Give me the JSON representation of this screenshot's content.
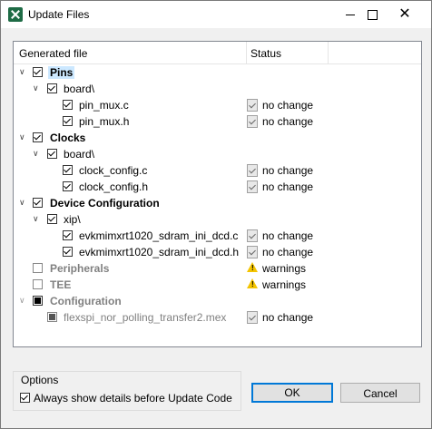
{
  "window": {
    "title": "Update Files"
  },
  "table": {
    "col_file": "Generated file",
    "col_status": "Status"
  },
  "rows": [
    {
      "label": "Pins",
      "status": ""
    },
    {
      "label": "board\\",
      "status": ""
    },
    {
      "label": "pin_mux.c",
      "status": "no change"
    },
    {
      "label": "pin_mux.h",
      "status": "no change"
    },
    {
      "label": "Clocks",
      "status": ""
    },
    {
      "label": "board\\",
      "status": ""
    },
    {
      "label": "clock_config.c",
      "status": "no change"
    },
    {
      "label": "clock_config.h",
      "status": "no change"
    },
    {
      "label": "Device Configuration",
      "status": ""
    },
    {
      "label": "xip\\",
      "status": ""
    },
    {
      "label": "evkmimxrt1020_sdram_ini_dcd.c",
      "status": "no change"
    },
    {
      "label": "evkmimxrt1020_sdram_ini_dcd.h",
      "status": "no change"
    },
    {
      "label": "Peripherals",
      "status": "warnings"
    },
    {
      "label": "TEE",
      "status": "warnings"
    },
    {
      "label": "Configuration",
      "status": ""
    },
    {
      "label": "flexspi_nor_polling_transfer2.mex",
      "status": "no change"
    }
  ],
  "options": {
    "title": "Options",
    "always_show_label": "Always show details before Update Code"
  },
  "buttons": {
    "ok": "OK",
    "cancel": "Cancel"
  }
}
